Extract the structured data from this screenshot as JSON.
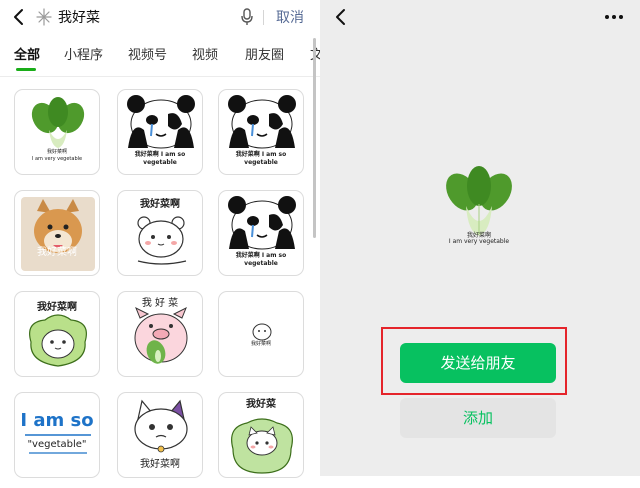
{
  "search": {
    "query": "我好菜",
    "cancel_label": "取消"
  },
  "tabs": [
    {
      "label": "全部",
      "active": true
    },
    {
      "label": "小程序"
    },
    {
      "label": "视频号"
    },
    {
      "label": "视频"
    },
    {
      "label": "朋友圈"
    },
    {
      "label": "文"
    }
  ],
  "stickers": [
    {
      "name": "bok-choy",
      "caption_line1": "我好菜啊",
      "caption_line2": "I am very vegetable"
    },
    {
      "name": "panda-crying-1",
      "caption_line1": "我好菜啊 I am so",
      "caption_line2": "vegetable"
    },
    {
      "name": "panda-crying-2",
      "caption_line1": "我好菜啊 I am so",
      "caption_line2": "vegetable"
    },
    {
      "name": "shiba-dog",
      "caption_line1": "我好菜啊"
    },
    {
      "name": "bear-lying",
      "caption_line1": "我好菜啊"
    },
    {
      "name": "panda-crying-3",
      "caption_line1": "我好菜啊 I am so",
      "caption_line2": "vegetable"
    },
    {
      "name": "cabbage-blob",
      "caption_line1": "我好菜啊"
    },
    {
      "name": "pig-holding-cabbage",
      "caption_line1": "我 好 菜"
    },
    {
      "name": "small-blob",
      "caption_line1": "我好菜啊"
    },
    {
      "name": "i-am-so-vegetable-text",
      "caption_line1": "I am so",
      "caption_line2": "\"vegetable\""
    },
    {
      "name": "sad-cat",
      "caption_line1": "我好菜啊"
    },
    {
      "name": "cat-in-cabbage",
      "caption_line1": "我好菜"
    }
  ],
  "preview": {
    "caption_line1": "我好菜啊",
    "caption_line2": "I am very vegetable"
  },
  "actions": {
    "send_label": "发送给朋友",
    "add_label": "添加"
  },
  "colors": {
    "accent_green": "#07c160",
    "link_blue": "#576b95",
    "highlight_red": "#e5242b"
  }
}
